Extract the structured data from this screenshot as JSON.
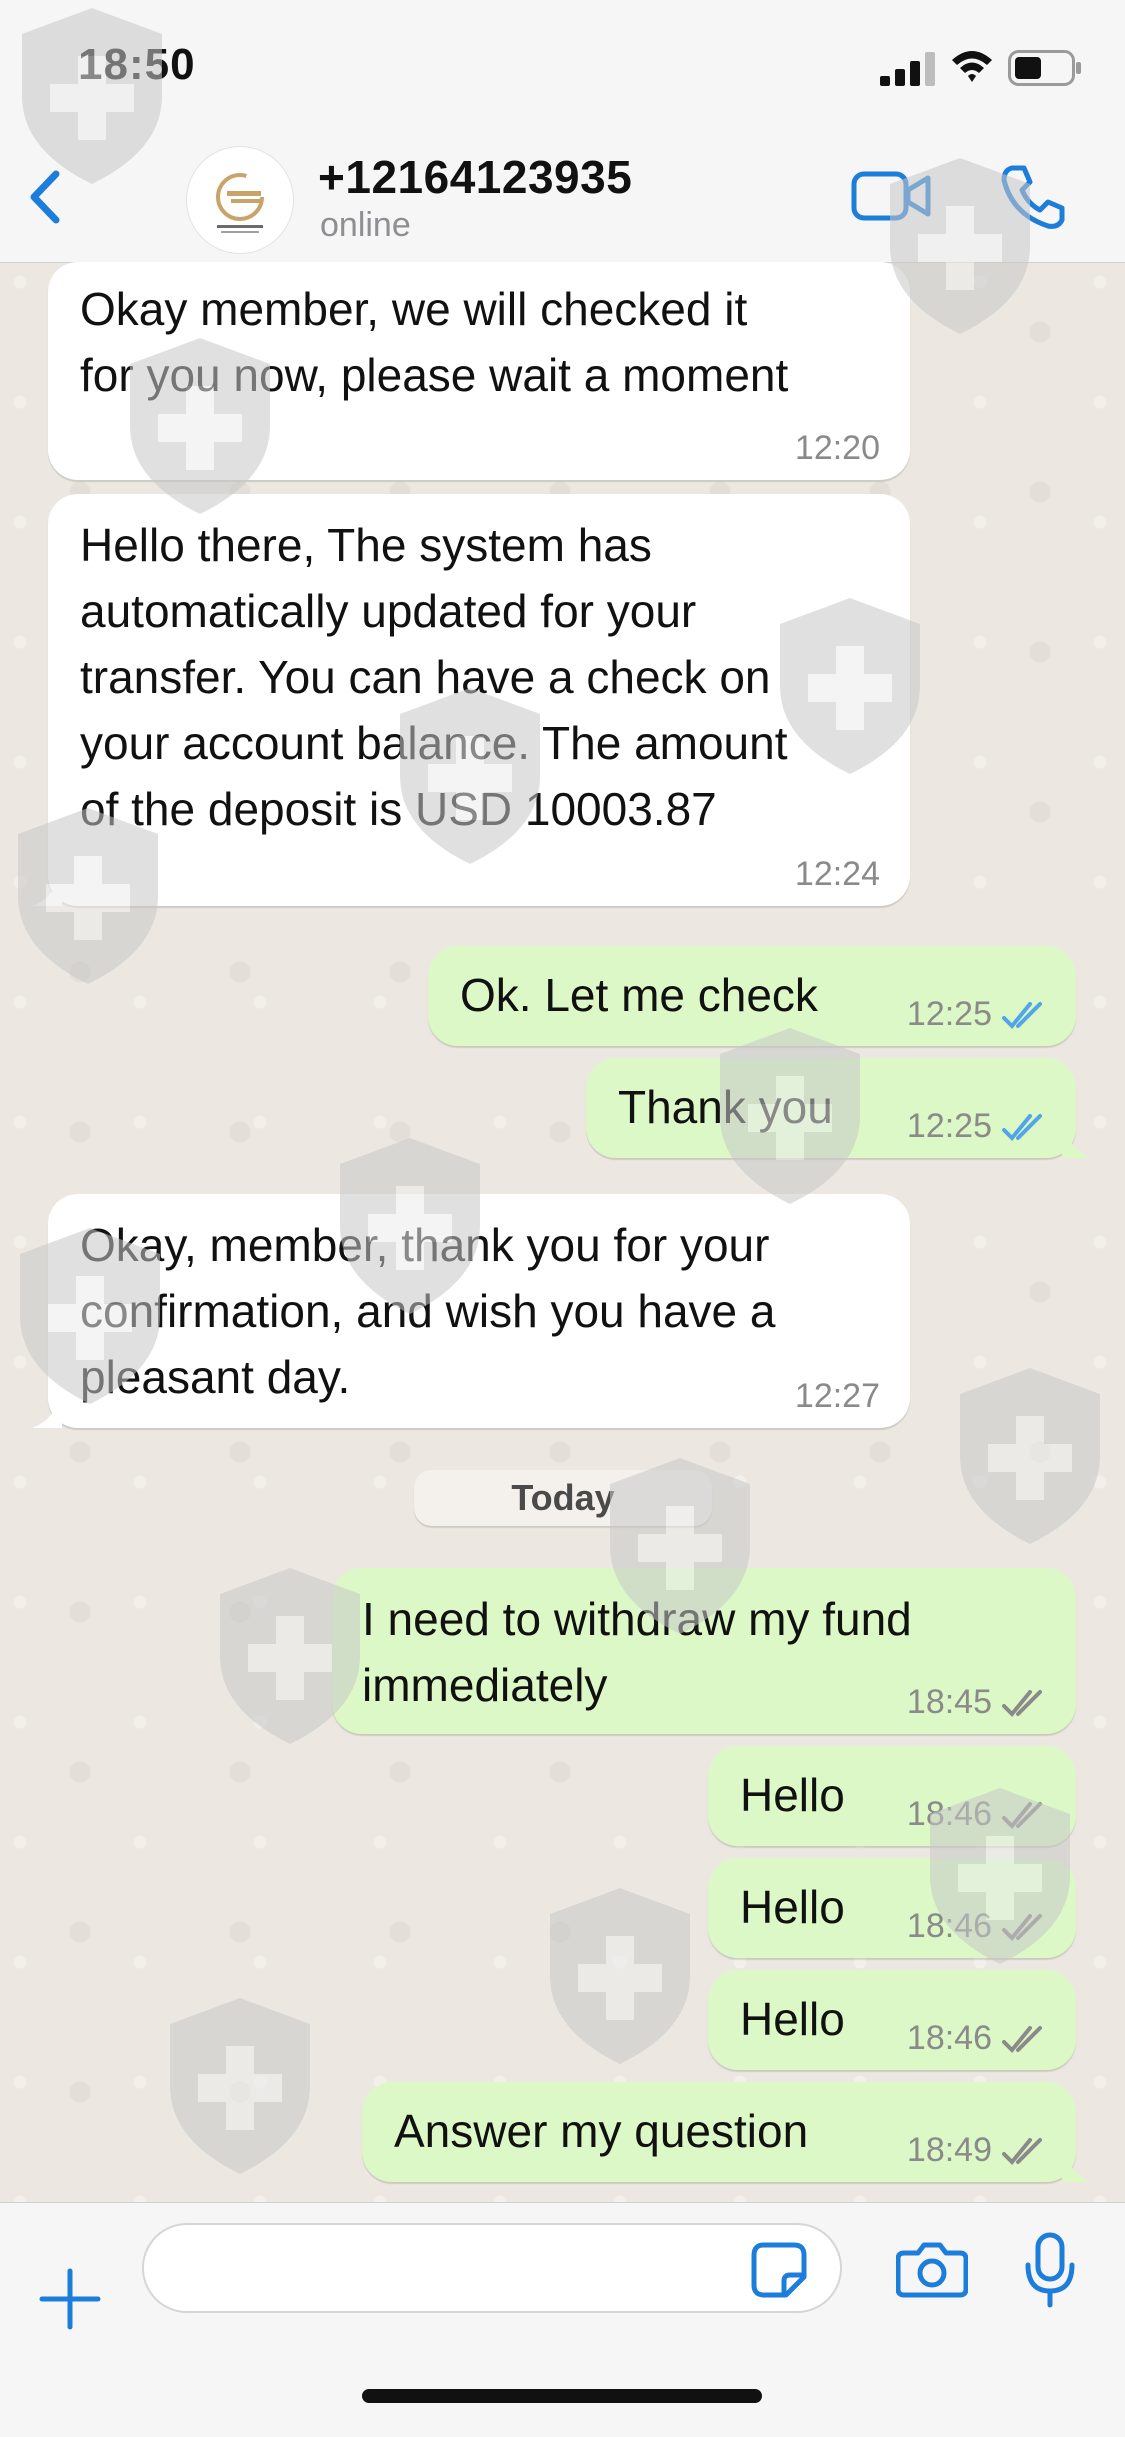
{
  "status_bar": {
    "time": "18:50"
  },
  "header": {
    "back_icon": "chevron-left-icon",
    "avatar_brand": "Gamal Securities",
    "contact_name": "+12164123935",
    "contact_status": "online",
    "video_icon": "video-camera-icon",
    "phone_icon": "phone-icon"
  },
  "messages": [
    {
      "direction": "incoming",
      "text": "Okay member, we will checked it\nfor you now, please wait a moment",
      "time": "12:20"
    },
    {
      "direction": "incoming",
      "text": "Hello there, The system has\nautomatically updated for your\ntransfer. You can have a check on\nyour account balance. The amount\nof the deposit is USD 10003.87",
      "time": "12:24"
    },
    {
      "direction": "outgoing",
      "text": "Ok. Let me check",
      "time": "12:25",
      "status": "read"
    },
    {
      "direction": "outgoing",
      "text": "Thank you",
      "time": "12:25",
      "status": "read"
    },
    {
      "direction": "incoming",
      "text": "Okay, member, thank you for your\nconfirmation, and wish you have a\npleasant day.",
      "time": "12:27"
    },
    {
      "direction": "outgoing",
      "text": "I need to withdraw my fund\nimmediately",
      "time": "18:45",
      "status": "delivered"
    },
    {
      "direction": "outgoing",
      "text": "Hello",
      "time": "18:46",
      "status": "delivered"
    },
    {
      "direction": "outgoing",
      "text": "Hello",
      "time": "18:46",
      "status": "delivered"
    },
    {
      "direction": "outgoing",
      "text": "Hello",
      "time": "18:46",
      "status": "delivered"
    },
    {
      "direction": "outgoing",
      "text": "Answer my question",
      "time": "18:49",
      "status": "delivered"
    }
  ],
  "date_divider": "Today",
  "input_bar": {
    "placeholder": "",
    "plus_icon": "plus-icon",
    "sticker_icon": "sticker-icon",
    "camera_icon": "camera-icon",
    "mic_icon": "microphone-icon"
  },
  "colors": {
    "accent": "#1c7ddb",
    "outgoing_bubble": "#dcf8c6",
    "incoming_bubble": "#ffffff",
    "read_check": "#4fa6e8",
    "delivered_check": "#8a8a8a",
    "chat_background": "#ece8e1"
  }
}
